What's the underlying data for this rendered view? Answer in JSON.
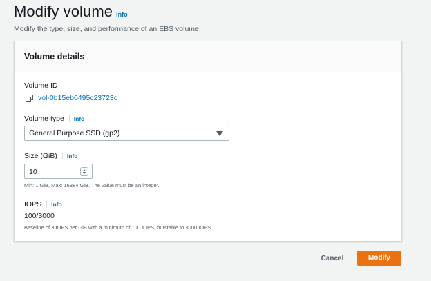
{
  "header": {
    "title": "Modify volume",
    "info": "Info",
    "description": "Modify the type, size, and performance of an EBS volume."
  },
  "panel": {
    "title": "Volume details",
    "volume_id": {
      "label": "Volume ID",
      "value": "vol-0b15eb0495c23723c",
      "icon": "copy-icon"
    },
    "volume_type": {
      "label": "Volume type",
      "info": "Info",
      "selected": "General Purpose SSD (gp2)"
    },
    "size": {
      "label": "Size (GiB)",
      "info": "Info",
      "value": "10",
      "hint": "Min: 1 GiB, Max: 16384 GiB. The value must be an integer."
    },
    "iops": {
      "label": "IOPS",
      "info": "Info",
      "value": "100/3000",
      "hint": "Baseline of 3 IOPS per GiB with a minimum of 100 IOPS, burstable to 3000 IOPS."
    }
  },
  "actions": {
    "cancel": "Cancel",
    "modify": "Modify"
  },
  "colors": {
    "background": "#f2f3f3",
    "link": "#0073bb",
    "primary": "#ec7211",
    "text": "#16191f",
    "muted": "#545b64"
  }
}
